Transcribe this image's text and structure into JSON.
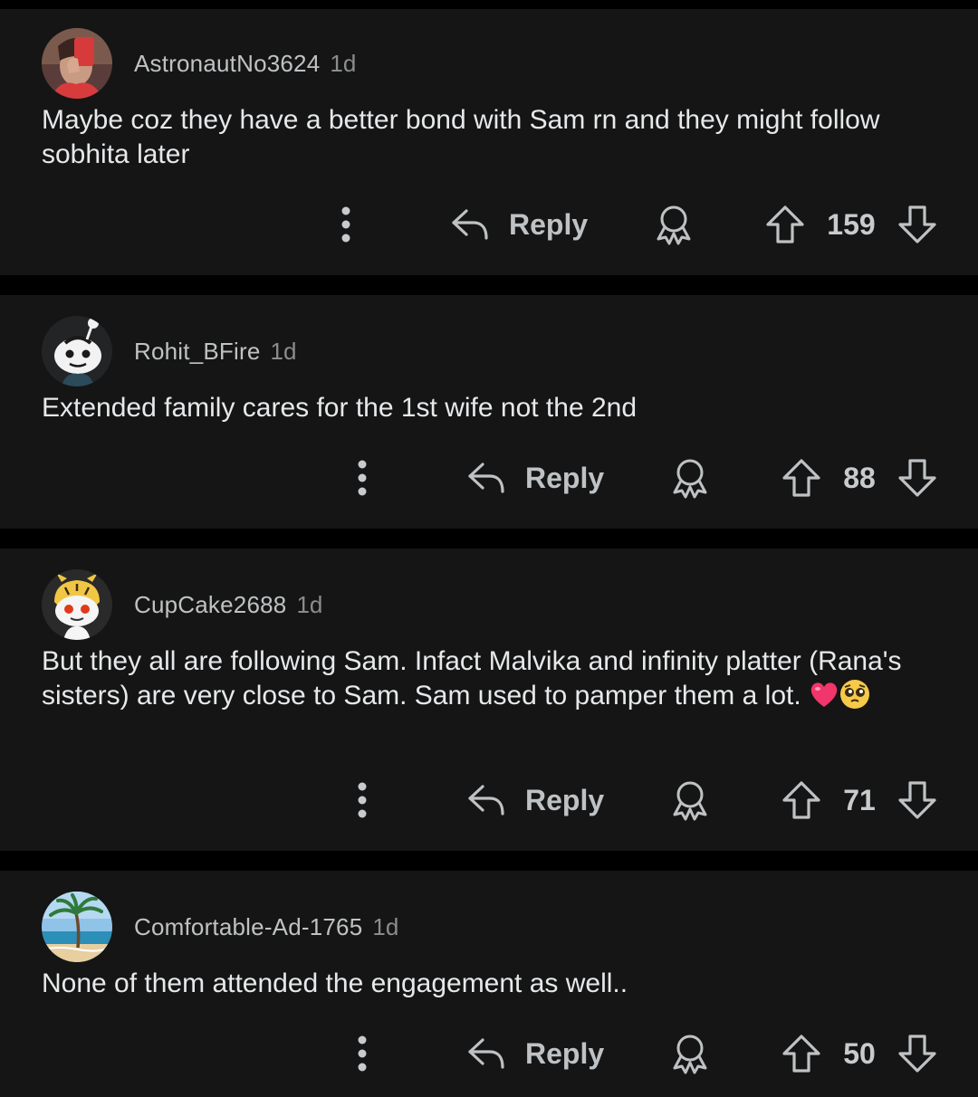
{
  "comments": [
    {
      "username": "AstronautNo3624",
      "time": "1d",
      "text": "Maybe coz they have a better bond with Sam rn and they might follow sobhita later",
      "reply_label": "Reply",
      "score": "159"
    },
    {
      "username": "Rohit_BFire",
      "time": "1d",
      "text": "Extended family cares for the 1st wife not the 2nd",
      "reply_label": "Reply",
      "score": "88"
    },
    {
      "username": "CupCake2688",
      "time": "1d",
      "text": "But they all are following Sam. Infact Malvika and infinity platter (Rana's sisters) are very close to Sam. Sam used to pamper them a lot.",
      "emojis": [
        "heart-emoji",
        "pleading-face-emoji"
      ],
      "reply_label": "Reply",
      "score": "71"
    },
    {
      "username": "Comfortable-Ad-1765",
      "time": "1d",
      "text": "None of them attended the engagement as well..",
      "reply_label": "Reply",
      "score": "50"
    }
  ],
  "icons": {
    "more": "vertical-dots-icon",
    "reply": "reply-arrow-icon",
    "award": "award-ribbon-icon",
    "upvote": "upvote-arrow-icon",
    "downvote": "downvote-arrow-icon"
  },
  "colors": {
    "background": "#000000",
    "card": "#151515",
    "text": "#e6e8ea",
    "muted": "#8a8d8f",
    "icon": "#bfc2c4"
  }
}
